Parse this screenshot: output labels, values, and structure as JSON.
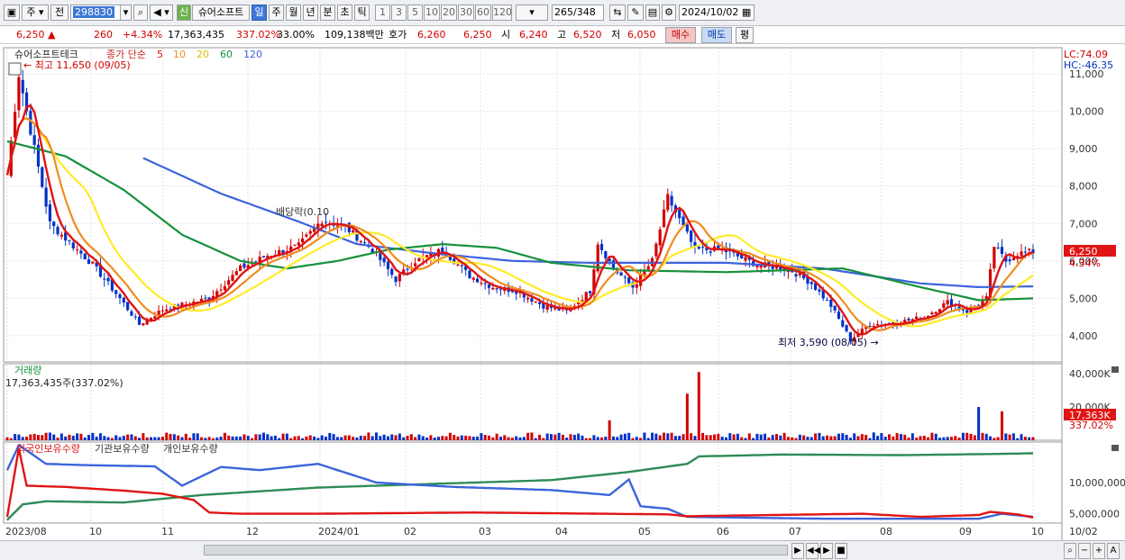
{
  "toolbar": {
    "period_label": "주",
    "prev_label": "전",
    "code": "298830",
    "new_badge": "신",
    "name": "슈어소프트",
    "tabs": [
      "일",
      "주",
      "월",
      "년",
      "분",
      "초",
      "틱"
    ],
    "selected_tab": "일",
    "ranges": [
      "1",
      "3",
      "5",
      "10",
      "20",
      "30",
      "60",
      "120"
    ],
    "count": "265",
    "total": "/348",
    "date": "2024/10/02"
  },
  "quote": {
    "price": "6,250 ▲",
    "change": "260",
    "change_pct": "+4.34%",
    "volume": "17,363,435",
    "volume_ratio": "337.02%",
    "turnover": "33.00%",
    "amount": "109,138백만",
    "ask_label": "호가",
    "ask1": "6,260",
    "ask2": "6,250",
    "open_label": "시",
    "open": "6,240",
    "high_label": "고",
    "high": "6,520",
    "low_label": "저",
    "low": "6,050",
    "buy_label": "매수",
    "sell_label": "매도",
    "avg_label": "평"
  },
  "colors": {
    "up": "#d40000",
    "down": "#0032c8",
    "ma5": "#e01414",
    "ma10": "#f08c1e",
    "ma20": "#ffeb28",
    "ma60": "#16913a",
    "ma120": "#3c64dc",
    "foreign": "#e01414",
    "institution": "#3c64dc",
    "individual": "#2e8b57"
  },
  "chart_data": [
    {
      "type": "line",
      "title": "슈어소프트테크",
      "legend": {
        "label": "종가 단순",
        "periods": [
          "5",
          "10",
          "20",
          "60",
          "120"
        ]
      },
      "x_ticks": [
        "2023/08",
        "10",
        "11",
        "12",
        "2024/01",
        "02",
        "03",
        "04",
        "05",
        "06",
        "07",
        "08",
        "09",
        "10"
      ],
      "x_extra": "10/02",
      "y_ticks": [
        "11,000",
        "10,000",
        "9,000",
        "8,000",
        "7,000",
        "6,000",
        "5,000",
        "4,000"
      ],
      "ylim": [
        3300,
        11700
      ],
      "lc": "LC:74.09",
      "hc": "HC:-46.35",
      "current_label": "6,250",
      "current_pct": "4.34%",
      "max_label": "최고 11,650 (09/05)",
      "min_label": "최저 3,590 (08/05)",
      "dividend_label": "배당락(0.10",
      "close_anchors": [
        [
          0,
          8300
        ],
        [
          3,
          11000
        ],
        [
          6,
          9500
        ],
        [
          11,
          7000
        ],
        [
          22,
          5900
        ],
        [
          29,
          5000
        ],
        [
          34,
          4300
        ],
        [
          40,
          4700
        ],
        [
          52,
          5000
        ],
        [
          60,
          5800
        ],
        [
          67,
          6150
        ],
        [
          75,
          6400
        ],
        [
          81,
          7100
        ],
        [
          87,
          6900
        ],
        [
          94,
          6300
        ],
        [
          100,
          5500
        ],
        [
          105,
          6000
        ],
        [
          112,
          6300
        ],
        [
          119,
          5600
        ],
        [
          125,
          5300
        ],
        [
          131,
          5200
        ],
        [
          138,
          4800
        ],
        [
          144,
          4650
        ],
        [
          150,
          5200
        ],
        [
          152,
          6500
        ],
        [
          156,
          5800
        ],
        [
          161,
          5300
        ],
        [
          166,
          6000
        ],
        [
          170,
          7700
        ],
        [
          177,
          6300
        ],
        [
          184,
          6300
        ],
        [
          193,
          5900
        ],
        [
          201,
          5800
        ],
        [
          207,
          5400
        ],
        [
          212,
          4800
        ],
        [
          217,
          3900
        ],
        [
          222,
          4300
        ],
        [
          229,
          4350
        ],
        [
          236,
          4500
        ],
        [
          242,
          4900
        ],
        [
          247,
          4650
        ],
        [
          252,
          5000
        ],
        [
          254,
          6400
        ],
        [
          257,
          6000
        ],
        [
          260,
          6200
        ],
        [
          264,
          6250
        ]
      ],
      "ma120_anchors": [
        [
          35,
          8750
        ],
        [
          55,
          7800
        ],
        [
          75,
          7050
        ],
        [
          90,
          6450
        ],
        [
          110,
          6200
        ],
        [
          130,
          6000
        ],
        [
          150,
          5950
        ],
        [
          185,
          5950
        ],
        [
          210,
          5800
        ],
        [
          235,
          5400
        ],
        [
          250,
          5300
        ],
        [
          264,
          5320
        ]
      ],
      "ma60_anchors": [
        [
          0,
          9200
        ],
        [
          15,
          8800
        ],
        [
          30,
          7900
        ],
        [
          45,
          6700
        ],
        [
          60,
          6000
        ],
        [
          72,
          5800
        ],
        [
          85,
          6000
        ],
        [
          98,
          6300
        ],
        [
          112,
          6450
        ],
        [
          126,
          6350
        ],
        [
          140,
          5950
        ],
        [
          160,
          5750
        ],
        [
          185,
          5700
        ],
        [
          200,
          5750
        ],
        [
          215,
          5800
        ],
        [
          235,
          5300
        ],
        [
          250,
          4950
        ],
        [
          264,
          5000
        ]
      ],
      "y_series": [
        {
          "name": "주",
          "y_ticks": [
            "40,000K",
            "20,000K"
          ],
          "label": "17,363K",
          "label_pct": "337.02%",
          "spikes": [
            [
              155,
              12000
            ],
            [
              175,
              28000
            ],
            [
              178,
              41000
            ],
            [
              250,
              20000
            ],
            [
              256,
              17363
            ]
          ],
          "title_label": "거래량",
          "value_label": "17,363,435주(337.02%)"
        }
      ]
    },
    {
      "type": "line",
      "legend": [
        "외국인보유수량",
        "기관보유수량",
        "개인보유수량"
      ],
      "y_ticks": [
        "10,000,000",
        "5,000,000"
      ],
      "ylim": [
        3500000,
        16500000
      ],
      "foreign_anchors": [
        [
          0,
          4500000
        ],
        [
          3,
          15500000
        ],
        [
          5,
          9500000
        ],
        [
          15,
          9300000
        ],
        [
          30,
          8700000
        ],
        [
          40,
          8200000
        ],
        [
          48,
          7200000
        ],
        [
          52,
          5200000
        ],
        [
          60,
          5000000
        ],
        [
          80,
          5000000
        ],
        [
          120,
          5200000
        ],
        [
          170,
          4900000
        ],
        [
          175,
          4600000
        ],
        [
          220,
          5000000
        ],
        [
          235,
          4500000
        ],
        [
          250,
          4800000
        ],
        [
          253,
          5300000
        ],
        [
          260,
          4900000
        ],
        [
          264,
          4400000
        ]
      ],
      "institution_anchors": [
        [
          0,
          12000000
        ],
        [
          3,
          16000000
        ],
        [
          10,
          13000000
        ],
        [
          20,
          12800000
        ],
        [
          38,
          12600000
        ],
        [
          45,
          9500000
        ],
        [
          55,
          12500000
        ],
        [
          65,
          12000000
        ],
        [
          80,
          13000000
        ],
        [
          95,
          10000000
        ],
        [
          115,
          9300000
        ],
        [
          140,
          8800000
        ],
        [
          155,
          8000000
        ],
        [
          160,
          10500000
        ],
        [
          163,
          6200000
        ],
        [
          170,
          5800000
        ],
        [
          175,
          4500000
        ],
        [
          210,
          4200000
        ],
        [
          250,
          4200000
        ],
        [
          256,
          5000000
        ],
        [
          264,
          4500000
        ]
      ],
      "individual_anchors": [
        [
          0,
          4000000
        ],
        [
          4,
          6500000
        ],
        [
          10,
          7000000
        ],
        [
          30,
          6800000
        ],
        [
          50,
          8000000
        ],
        [
          80,
          9200000
        ],
        [
          110,
          9800000
        ],
        [
          140,
          10400000
        ],
        [
          160,
          11700000
        ],
        [
          175,
          13000000
        ],
        [
          178,
          14200000
        ],
        [
          200,
          14500000
        ],
        [
          230,
          14400000
        ],
        [
          255,
          14600000
        ],
        [
          264,
          14700000
        ]
      ]
    }
  ]
}
